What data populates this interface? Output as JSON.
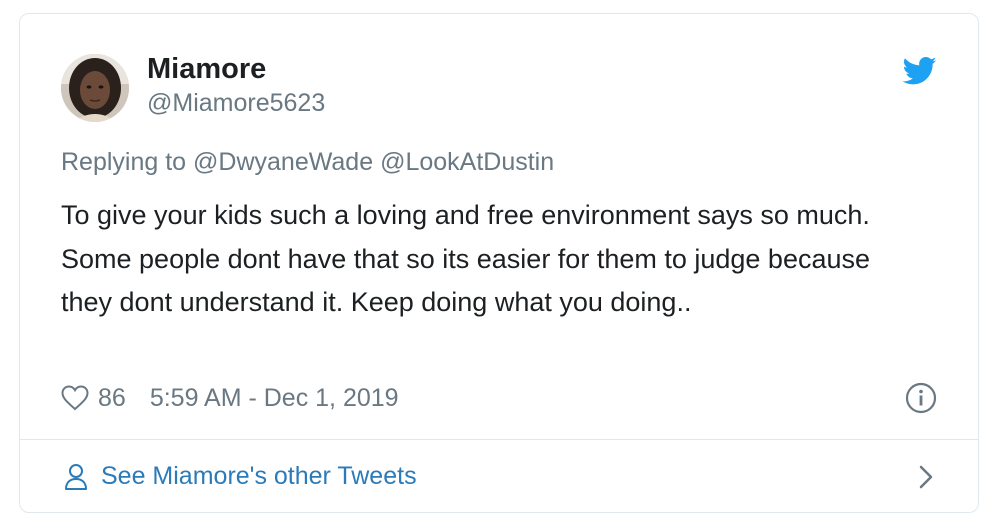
{
  "author": {
    "display_name": "Miamore",
    "handle": "@Miamore5623"
  },
  "reply": {
    "prefix": "Replying to",
    "mentions": [
      "@DwyaneWade",
      "@LookAtDustin"
    ]
  },
  "tweet": {
    "text": "To give your kids such a loving and free environment says so much. Some people dont have that so its easier for them to judge because they dont understand it. Keep doing what you doing.."
  },
  "meta": {
    "likes": "86",
    "timestamp": "5:59 AM - Dec 1, 2019"
  },
  "footer": {
    "link_text": "See Miamore's other Tweets"
  },
  "icons": {
    "brand": "twitter-bird-icon",
    "like": "heart-icon",
    "info": "info-icon",
    "profile": "person-icon",
    "navigate": "chevron-right-icon"
  },
  "colors": {
    "text": "#1c2022",
    "secondary": "#697882",
    "link": "#2b7bb9",
    "twitter_blue": "#1da1f2",
    "border": "#e1e8ed"
  }
}
